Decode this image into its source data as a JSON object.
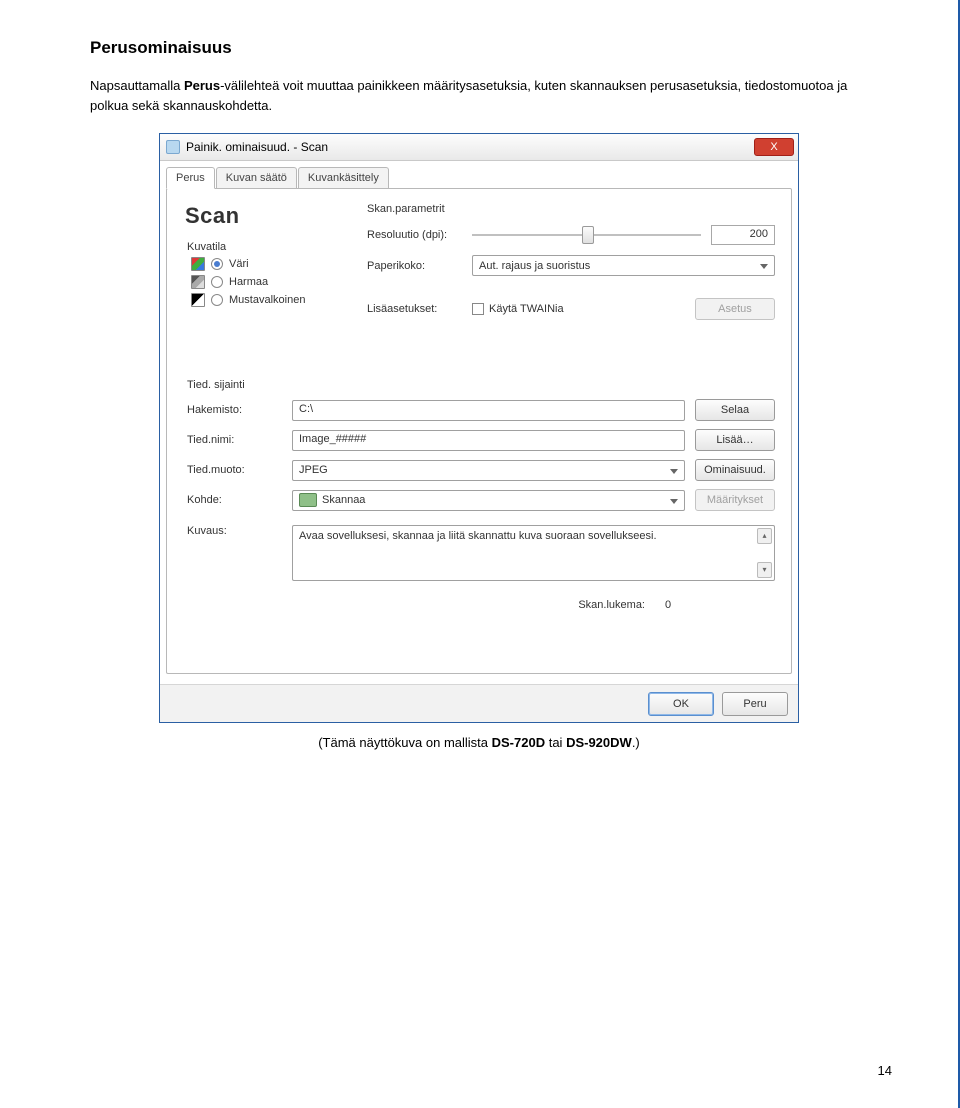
{
  "page": {
    "heading": "Perusominaisuus",
    "intro_before": "Napsauttamalla ",
    "intro_bold": "Perus",
    "intro_after": "-välilehteä voit muuttaa painikkeen määritysasetuksia, kuten skannauksen perusasetuksia, tiedostomuotoa ja polkua sekä skannauskohdetta.",
    "caption_before": "(Tämä näyttökuva on mallista ",
    "caption_bold1": "DS-720D",
    "caption_mid": " tai ",
    "caption_bold2": "DS-920DW",
    "caption_after": ".)",
    "number": "14"
  },
  "window": {
    "title": "Painik. ominaisuud. - Scan",
    "close": "X",
    "tabs": [
      "Perus",
      "Kuvan säätö",
      "Kuvankäsittely"
    ],
    "scanTitle": "Scan",
    "imageMode": {
      "label": "Kuvatila",
      "options": {
        "color": "Väri",
        "gray": "Harmaa",
        "bw": "Mustavalkoinen"
      },
      "selected": "color"
    },
    "params": {
      "title": "Skan.parametrit",
      "resolutionLabel": "Resoluutio (dpi):",
      "resolutionValue": "200",
      "paperLabel": "Paperikoko:",
      "paperValue": "Aut. rajaus ja suoristus",
      "extraLabel": "Lisäasetukset:",
      "twainLabel": "Käytä TWAINia",
      "settingBtn": "Asetus"
    },
    "file": {
      "sectionTitle": "Tied. sijainti",
      "dirLabel": "Hakemisto:",
      "dirValue": "C:\\",
      "browseBtn": "Selaa",
      "nameLabel": "Tied.nimi:",
      "nameValue": "Image_#####",
      "moreBtn": "Lisää…",
      "fmtLabel": "Tied.muoto:",
      "fmtValue": "JPEG",
      "propBtn": "Ominaisuud.",
      "targetLabel": "Kohde:",
      "targetValue": "Skannaa",
      "setupBtn": "Määritykset",
      "descLabel": "Kuvaus:",
      "descValue": "Avaa sovelluksesi, skannaa ja liitä skannattu kuva suoraan sovellukseesi.",
      "countLabel": "Skan.lukema:",
      "countValue": "0"
    },
    "footer": {
      "ok": "OK",
      "cancel": "Peru"
    }
  }
}
